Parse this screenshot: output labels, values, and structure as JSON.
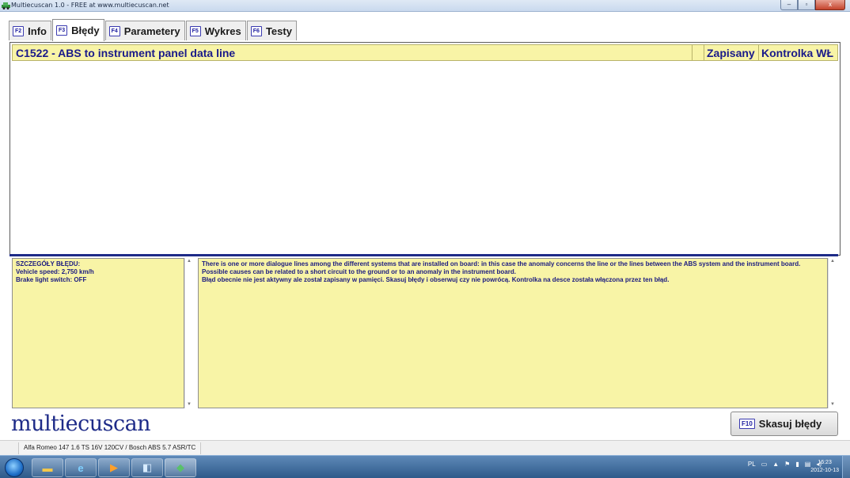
{
  "window": {
    "title": "Multiecuscan 1.0 - FREE at www.multiecuscan.net",
    "buttons": {
      "minimize": "–",
      "maximize": "▫",
      "close": "x"
    }
  },
  "tabs": [
    {
      "key": "F2",
      "label": "Info",
      "active": false
    },
    {
      "key": "F3",
      "label": "Błędy",
      "active": true
    },
    {
      "key": "F4",
      "label": "Parametery",
      "active": false
    },
    {
      "key": "F5",
      "label": "Wykres",
      "active": false
    },
    {
      "key": "F6",
      "label": "Testy",
      "active": false
    }
  ],
  "fault": {
    "code_description": "C1522 - ABS to instrument panel data line",
    "col_saved": "Zapisany",
    "col_lamp": "Kontrolka WŁ"
  },
  "details": {
    "heading": "SZCZEGÓŁY BŁĘDU:",
    "lines": [
      "Vehicle speed: 2,750 km/h",
      "Brake light switch: OFF"
    ]
  },
  "description": {
    "lines": [
      "There is one or more dialogue lines among the different systems that are installed on board: in this case the anomaly concerns the line or the lines between the ABS system and the instrument board.",
      "Possible causes can be related to a short circuit to the ground or to an anomaly in the instrument board.",
      "Błąd obecnie nie jest aktywny ale został zapisany w pamięci. Skasuj błędy i obserwuj czy nie powrócą. Kontrolka na desce została włączona przez ten błąd."
    ]
  },
  "logo": "multiecuscan",
  "clear_button": {
    "key": "F10",
    "label": "Skasuj błędy"
  },
  "status": "Alfa Romeo 147 1.6 TS 16V 120CV / Bosch ABS 5.7 ASR/TC",
  "taskbar": {
    "icons": [
      "start-orb",
      "file-explorer",
      "internet-explorer",
      "media-player",
      "notes-app",
      "multiecuscan-app"
    ],
    "lang": "PL",
    "time": "16:23",
    "date": "2012-10-13"
  },
  "colors": {
    "header_bg": "#f8f4a6",
    "accent_navy": "#1e2b88",
    "text_navy": "#1a1a8a"
  }
}
